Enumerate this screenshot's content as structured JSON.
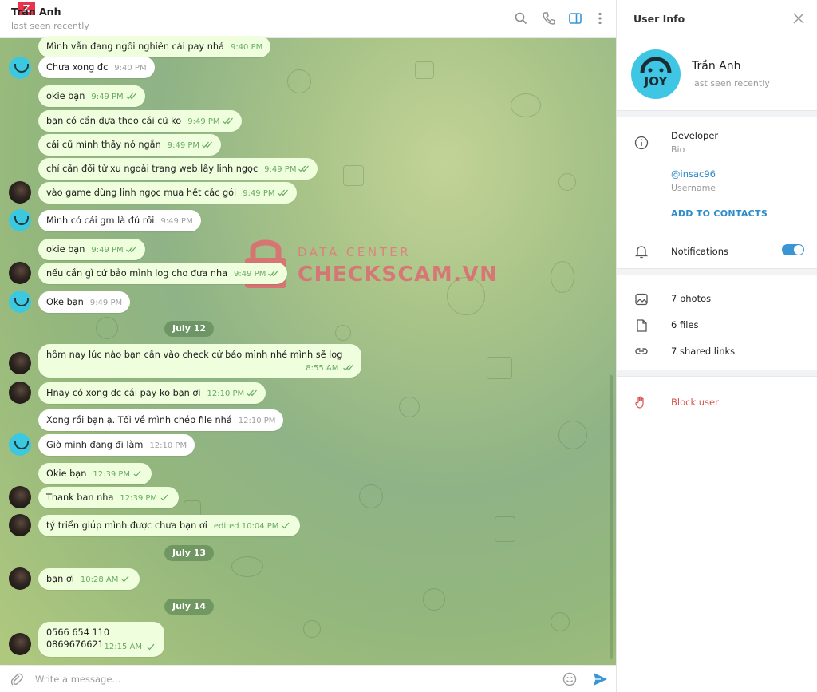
{
  "header": {
    "title_logo": "Z",
    "contact_name": "Trần Anh",
    "status": "last seen recently",
    "icons": [
      "search-icon",
      "phone-icon",
      "sidebar-toggle-icon",
      "more-icon"
    ]
  },
  "messages": [
    {
      "dir": "out",
      "text": "Mình vẫn đang ngồi nghiên cái pay nhá",
      "time": "9:40 PM"
    },
    {
      "dir": "in",
      "avatar": "joy",
      "text": "Chưa xong đc",
      "time": "9:40 PM"
    },
    {
      "dir": "out",
      "text": "okie bạn",
      "time": "9:49 PM",
      "read": true
    },
    {
      "dir": "out",
      "text": "bạn có cần dựa theo cái cũ ko",
      "time": "9:49 PM",
      "read": true
    },
    {
      "dir": "out",
      "text": "cái cũ mình thấy nó ngắn",
      "time": "9:49 PM",
      "read": true
    },
    {
      "dir": "out",
      "text": "chỉ cần đổi từ xu ngoài trang web lấy linh ngọc",
      "time": "9:49 PM",
      "read": true
    },
    {
      "dir": "out",
      "avatar": "dark",
      "text": "vào game dùng linh ngọc mua hết các gói",
      "time": "9:49 PM",
      "read": true
    },
    {
      "dir": "in",
      "avatar": "joy",
      "text": "Mình có cái gm là đủ rồi",
      "time": "9:49 PM"
    },
    {
      "dir": "out",
      "text": "okie bạn",
      "time": "9:49 PM",
      "read": true
    },
    {
      "dir": "out",
      "avatar": "dark",
      "text": "nếu cần gì cứ bảo mình log cho đưa nha",
      "time": "9:49 PM",
      "read": true
    },
    {
      "dir": "in",
      "avatar": "joy",
      "text": "Oke bạn",
      "time": "9:49 PM"
    },
    {
      "dir": "out",
      "avatar": "dark",
      "text": "hôm nay lúc nào bạn cần vào check cứ báo mình nhé mình sẽ log",
      "time": "8:55 AM",
      "read": true
    },
    {
      "dir": "out",
      "avatar": "dark",
      "text": "Hnay có xong dc cái pay ko bạn ơi",
      "time": "12:10 PM",
      "read": true
    },
    {
      "dir": "in",
      "text": "Xong rồi bạn ạ. Tối về mình chép file nhá",
      "time": "12:10 PM"
    },
    {
      "dir": "in",
      "avatar": "joy",
      "text": "Giờ mình đang đi làm",
      "time": "12:10 PM"
    },
    {
      "dir": "out",
      "text": "Okie bạn",
      "time": "12:39 PM",
      "read": false
    },
    {
      "dir": "out",
      "avatar": "dark",
      "text": "Thank bạn nha",
      "time": "12:39 PM",
      "read": false
    },
    {
      "dir": "out",
      "avatar": "dark",
      "text": "tý triển giúp mình được chưa bạn ơi",
      "time": "edited 10:04 PM",
      "read": false
    },
    {
      "dir": "out",
      "avatar": "dark",
      "text": "bạn ơi",
      "time": "10:28 AM",
      "read": false
    },
    {
      "dir": "out",
      "avatar": "dark",
      "line1": "0566 654 110",
      "line2": "0869676621",
      "time": "12:15 AM",
      "read": false
    }
  ],
  "dates": [
    "July 12",
    "July 13",
    "July 14"
  ],
  "watermark": {
    "line1": "DATA CENTER",
    "line2": "CHECKSCAM.VN"
  },
  "compose": {
    "placeholder": "Write a message..."
  },
  "panel": {
    "title": "User Info",
    "name": "Trần Anh",
    "status": "last seen recently",
    "avatar_text": "JOY",
    "bio": "Developer",
    "bio_label": "Bio",
    "username": "@insac96",
    "username_label": "Username",
    "add_contact": "ADD TO CONTACTS",
    "notifications": "Notifications",
    "notifications_on": true,
    "photos": "7 photos",
    "files": "6 files",
    "links": "7 shared links",
    "block": "Block user"
  },
  "colors": {
    "accent": "#3a95d5",
    "outgoing_bubble": "#effedd",
    "danger": "#d9534f"
  }
}
